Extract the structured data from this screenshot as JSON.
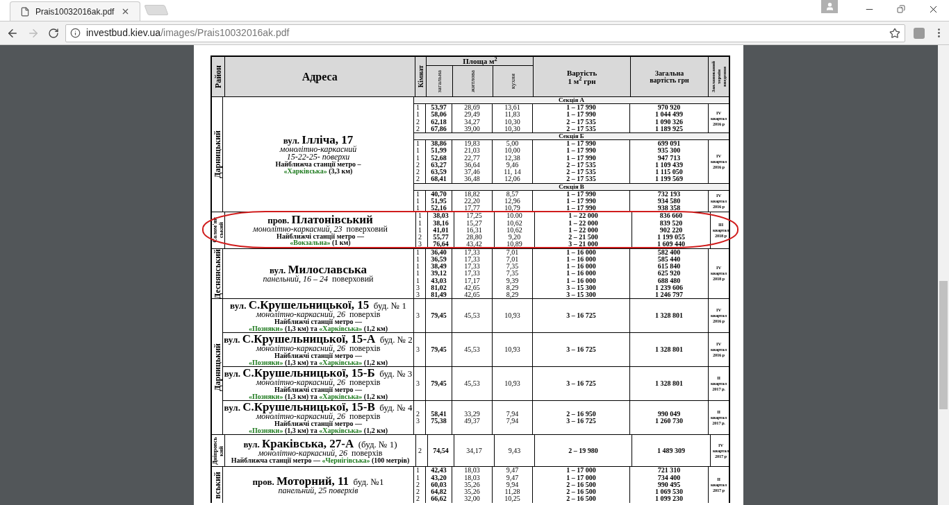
{
  "browser": {
    "tab": {
      "title": "Prais10032016ak.pdf"
    },
    "address": {
      "domain": "investbud.kiev.ua",
      "path": "/images/Prais10032016ak.pdf"
    }
  },
  "table": {
    "headers": {
      "district": "Район",
      "address": "Адреса",
      "rooms": "Кімнат",
      "area": "Площа м$^{2}$",
      "area_total": "загальна",
      "area_living": "житлова",
      "area_kitchen": "кухня",
      "price_m2": [
        "Вартість",
        "1 м$^{2}$ грн"
      ],
      "price_total": [
        "Загальна",
        "вартість грн"
      ],
      "term": [
        "Запланований",
        "термін",
        "введення"
      ]
    },
    "groups": [
      {
        "district": [
          "Дарницький"
        ],
        "blocks": [
          {
            "address": [
              {
                "kind": "street",
                "prefix": "вул.",
                "name": "Ілліча, 17"
              },
              {
                "kind": "type",
                "italic": "монолітно-каркасний"
              },
              {
                "kind": "type",
                "italic": "15-22-25- поверхи"
              },
              {
                "kind": "note",
                "text": "Найближча станції метро –"
              },
              {
                "kind": "metro",
                "segments": [
                  {
                    "kind": "station",
                    "text": "«Харківська»"
                  },
                  {
                    "kind": "plain",
                    "text": " (3,3 км)"
                  }
                ]
              }
            ],
            "sections": [
              {
                "title": "Секція А",
                "term": [
                  "IV",
                  "квартал",
                  "2016 р"
                ],
                "rows": [
                  [
                    "1",
                    "53,97",
                    "28,69",
                    "13,61",
                    "1 – 17 990",
                    "970 920"
                  ],
                  [
                    "1",
                    "58,06",
                    "29,49",
                    "11,83",
                    "1 – 17 990",
                    "1 044 499"
                  ],
                  [
                    "2",
                    "62,18",
                    "34,27",
                    "10,30",
                    "2 – 17 535",
                    "1 090 326"
                  ],
                  [
                    "2",
                    "67,86",
                    "39,00",
                    "10,30",
                    "2 – 17 535",
                    "1 189 925"
                  ]
                ]
              },
              {
                "title": "Секція Б",
                "term": [
                  "IV",
                  "квартал",
                  "2016 р"
                ],
                "rows": [
                  [
                    "1",
                    "38,86",
                    "19,83",
                    "5,00",
                    "1 – 17 990",
                    "699 091"
                  ],
                  [
                    "1",
                    "51,99",
                    "21,03",
                    "10,00",
                    "1 – 17 990",
                    "935 300"
                  ],
                  [
                    "1",
                    "52,68",
                    "22,77",
                    "12,38",
                    "1 – 17 990",
                    "947 713"
                  ],
                  [
                    "2",
                    "63,27",
                    "36,64",
                    "9,46",
                    "2 – 17 535",
                    "1 109 439"
                  ],
                  [
                    "2",
                    "63,59",
                    "37,46",
                    "11, 14",
                    "2 – 17 535",
                    "1 115 050"
                  ],
                  [
                    "2",
                    "68,41",
                    "36,48",
                    "12,06",
                    "2 – 17 535",
                    "1 199 569"
                  ]
                ]
              },
              {
                "title": "Секція В",
                "term": [
                  "IV",
                  "квартал",
                  "2016 р"
                ],
                "rows": [
                  [
                    "1",
                    "40,70",
                    "18,82",
                    "8,57",
                    "1 – 17 990",
                    "732 193"
                  ],
                  [
                    "1",
                    "51,95",
                    "22,20",
                    "12,96",
                    "1 – 17 990",
                    "934 580"
                  ],
                  [
                    "1",
                    "52,16",
                    "17,77",
                    "10,79",
                    "1 – 17 990",
                    "938 358"
                  ]
                ]
              }
            ]
          }
        ]
      },
      {
        "district": [
          "Солом'ян",
          "ський"
        ],
        "blocks": [
          {
            "address": [
              {
                "kind": "street",
                "prefix": "пров.",
                "name": "Платонівський"
              },
              {
                "kind": "type",
                "italic": "монолітно-каркасний, 23",
                "plain": "поверховий"
              },
              {
                "kind": "note",
                "text": "Найближчі станції метро —"
              },
              {
                "kind": "metro",
                "segments": [
                  {
                    "kind": "station",
                    "text": "«Вокзальна»"
                  },
                  {
                    "kind": "plain",
                    "text": " (1 км)"
                  }
                ]
              }
            ],
            "sections": [
              {
                "term": [
                  "III",
                  "квартал",
                  "2018 р"
                ],
                "rows": [
                  [
                    "1",
                    "38,03",
                    "17,25",
                    "10.00",
                    "1 – 22 000",
                    "836 660"
                  ],
                  [
                    "1",
                    "38,16",
                    "15,27",
                    "10,62",
                    "1 – 22 000",
                    "839 520"
                  ],
                  [
                    "1",
                    "41,01",
                    "16,31",
                    "10,62",
                    "1 – 22 000",
                    "902 220"
                  ],
                  [
                    "2",
                    "55,77",
                    "28,80",
                    "9,20",
                    "2 – 21 500",
                    "1 199 055"
                  ],
                  [
                    "3",
                    "76,64",
                    "43,42",
                    "10,89",
                    "3 – 21 000",
                    "1 609 440"
                  ]
                ]
              }
            ]
          }
        ]
      },
      {
        "district": [
          "Деснянський"
        ],
        "blocks": [
          {
            "address": [
              {
                "kind": "street",
                "prefix": "вул.",
                "name": "Милославська"
              },
              {
                "kind": "type",
                "italic": "панельний, 16 – 24",
                "plain": "поверховий"
              }
            ],
            "sections": [
              {
                "term": [
                  "IV",
                  "квартал",
                  "2018 р"
                ],
                "rows": [
                  [
                    "1",
                    "36,40",
                    "17,33",
                    "7,01",
                    "1 – 16 000",
                    "582 400"
                  ],
                  [
                    "1",
                    "36,59",
                    "17,33",
                    "7,01",
                    "1 – 16 000",
                    "585 440"
                  ],
                  [
                    "1",
                    "38,49",
                    "17,33",
                    "7,35",
                    "1 – 16 000",
                    "615 840"
                  ],
                  [
                    "1",
                    "39,12",
                    "17,33",
                    "7,35",
                    "1 – 16 000",
                    "625 920"
                  ],
                  [
                    "1",
                    "43,03",
                    "17,17",
                    "9,39",
                    "1 – 16 000",
                    "688 480"
                  ],
                  [
                    "3",
                    "81,02",
                    "42,65",
                    "8,29",
                    "3 – 15 300",
                    "1 239 606"
                  ],
                  [
                    "3",
                    "81,49",
                    "42,65",
                    "8,29",
                    "3 – 15 300",
                    "1 246 797"
                  ]
                ]
              }
            ]
          }
        ]
      },
      {
        "district": [
          "Дарницький"
        ],
        "blocks": [
          {
            "address": [
              {
                "kind": "street",
                "prefix": "вул.",
                "name": "С.Крушельницької, 15",
                "suffix": "буд. № 1"
              },
              {
                "kind": "type",
                "italic": "монолітно-каркасний, 26",
                "plain": "поверхів"
              },
              {
                "kind": "note",
                "text": "Найближчі станції метро —"
              },
              {
                "kind": "metro",
                "segments": [
                  {
                    "kind": "station",
                    "text": "«Позняки»"
                  },
                  {
                    "kind": "plain",
                    "text": " (1,3 км) та "
                  },
                  {
                    "kind": "station",
                    "text": "«Харківська»"
                  },
                  {
                    "kind": "plain",
                    "text": " (1,2 км)"
                  }
                ]
              }
            ],
            "sections": [
              {
                "term": [
                  "IV",
                  "квартал",
                  "2016 р"
                ],
                "rows": [
                  [
                    "3",
                    "79,45",
                    "45,53",
                    "10,93",
                    "3 – 16 725",
                    "1 328 801"
                  ]
                ]
              }
            ]
          },
          {
            "address": [
              {
                "kind": "street",
                "prefix": "вул.",
                "name": "С.Крушельницької, 15-А",
                "suffix": "буд. № 2"
              },
              {
                "kind": "type",
                "italic": "монолітно-каркасний, 26",
                "plain": "поверхів"
              },
              {
                "kind": "note",
                "text": "Найближчі станції метро —"
              },
              {
                "kind": "metro",
                "segments": [
                  {
                    "kind": "station",
                    "text": "«Позняки»"
                  },
                  {
                    "kind": "plain",
                    "text": " (1,3 км) та "
                  },
                  {
                    "kind": "station",
                    "text": "«Харківська»"
                  },
                  {
                    "kind": "plain",
                    "text": " (1,2 км)"
                  }
                ]
              }
            ],
            "sections": [
              {
                "term": [
                  "IV",
                  "квартал",
                  "2016 р"
                ],
                "rows": [
                  [
                    "3",
                    "79,45",
                    "45,53",
                    "10,93",
                    "3 – 16 725",
                    "1 328 801"
                  ]
                ]
              }
            ]
          },
          {
            "address": [
              {
                "kind": "street",
                "prefix": "вул.",
                "name": "С.Крушельницької, 15-Б",
                "suffix": "буд. № 3"
              },
              {
                "kind": "type",
                "italic": "монолітно-каркасний, 26",
                "plain": "поверхів"
              },
              {
                "kind": "note",
                "text": "Найближчі станції метро —"
              },
              {
                "kind": "metro",
                "segments": [
                  {
                    "kind": "station",
                    "text": "«Позняки»"
                  },
                  {
                    "kind": "plain",
                    "text": " (1,3 км) та "
                  },
                  {
                    "kind": "station",
                    "text": "«Харківська»"
                  },
                  {
                    "kind": "plain",
                    "text": " (1,2 км)"
                  }
                ]
              }
            ],
            "sections": [
              {
                "term": [
                  "II",
                  "квартал",
                  "2017 р."
                ],
                "rows": [
                  [
                    "3",
                    "79,45",
                    "45,53",
                    "10,93",
                    "3 – 16 725",
                    "1 328 801"
                  ]
                ]
              }
            ]
          },
          {
            "address": [
              {
                "kind": "street",
                "prefix": "вул.",
                "name": "С.Крушельницької, 15-В",
                "suffix": "буд. № 4"
              },
              {
                "kind": "type",
                "italic": "монолітно-каркасний, 26",
                "plain": "поверхів"
              },
              {
                "kind": "note",
                "text": "Найближчі станції метро —"
              },
              {
                "kind": "metro",
                "segments": [
                  {
                    "kind": "station",
                    "text": "«Позняки»"
                  },
                  {
                    "kind": "plain",
                    "text": " (1,3 км) та "
                  },
                  {
                    "kind": "station",
                    "text": "«Харківська»"
                  },
                  {
                    "kind": "plain",
                    "text": " (1,2 км)"
                  }
                ]
              }
            ],
            "sections": [
              {
                "term": [
                  "II",
                  "квартал",
                  "2017 р."
                ],
                "rows": [
                  [
                    "2",
                    "58,41",
                    "33,29",
                    "7,94",
                    "2 – 16 950",
                    "990 049"
                  ],
                  [
                    "3",
                    "75,38",
                    "49,37",
                    "7,94",
                    "3 – 16 725",
                    "1 260 730"
                  ]
                ]
              }
            ]
          }
        ]
      },
      {
        "district": [
          "Дніпровсь",
          "кий"
        ],
        "blocks": [
          {
            "address": [
              {
                "kind": "street",
                "prefix": "вул.",
                "name": "Краківська, 27-А",
                "suffix": "(буд. № 1)"
              },
              {
                "kind": "type",
                "italic": "монолітно-каркасний, 26",
                "plain": "поверхів"
              },
              {
                "kind": "metro",
                "segments": [
                  {
                    "kind": "plain",
                    "text": "Найближча станції метро — "
                  },
                  {
                    "kind": "station",
                    "text": "«Чернігівська»"
                  },
                  {
                    "kind": "plain",
                    "text": " (100 метрів)"
                  }
                ]
              }
            ],
            "sections": [
              {
                "term": [
                  "IV",
                  "квартал",
                  "2017 р"
                ],
                "rows": [
                  [
                    "2",
                    "74,54",
                    "34,17",
                    "9,43",
                    "2 – 19 980",
                    "1 489 309"
                  ]
                ]
              }
            ]
          }
        ]
      },
      {
        "district": [
          "вський"
        ],
        "blocks": [
          {
            "address": [
              {
                "kind": "street",
                "prefix": "пров.",
                "name": "Моторний, 11",
                "suffix": "буд. №1"
              },
              {
                "kind": "type",
                "italic": "панельний, 25 поверхів"
              }
            ],
            "sections": [
              {
                "term": [
                  "II",
                  "квартал",
                  "2017 р"
                ],
                "rows": [
                  [
                    "1",
                    "42,43",
                    "18,03",
                    "9,47",
                    "1 – 17 000",
                    "721 310"
                  ],
                  [
                    "1",
                    "43,20",
                    "18,03",
                    "9,47",
                    "1 – 17 000",
                    "734 400"
                  ],
                  [
                    "2",
                    "60,03",
                    "35,26",
                    "9,94",
                    "2 – 16 500",
                    "990 495"
                  ],
                  [
                    "2",
                    "64,82",
                    "35,26",
                    "11,28",
                    "2 – 16 500",
                    "1 069 530"
                  ],
                  [
                    "2",
                    "66,62",
                    "32,00",
                    "10,25",
                    "2 – 16 500",
                    "1 099 230"
                  ]
                ]
              }
            ]
          }
        ]
      }
    ]
  }
}
